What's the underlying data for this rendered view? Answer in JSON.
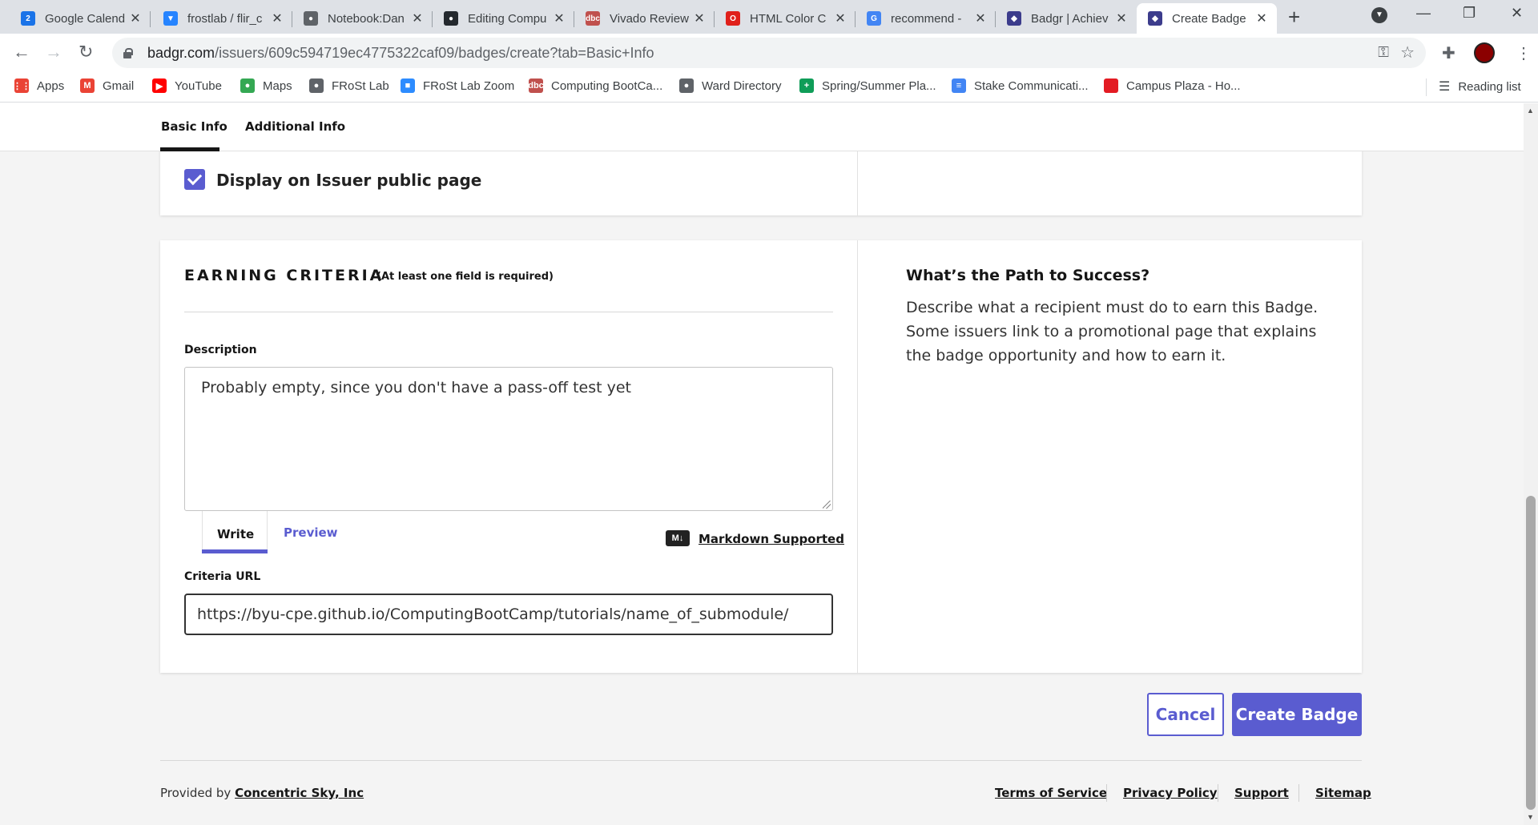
{
  "browser": {
    "tabs": [
      {
        "title": "Google Calend",
        "icon": "calendar-icon",
        "color": "#1a73e8",
        "glyph": "2"
      },
      {
        "title": "frostlab / flir_c",
        "icon": "bookmark-icon",
        "color": "#2684ff",
        "glyph": "▼"
      },
      {
        "title": "Notebook:Dan",
        "icon": "globe-icon",
        "color": "#5f6368",
        "glyph": "●"
      },
      {
        "title": "Editing Compu",
        "icon": "github-icon",
        "color": "#24292e",
        "glyph": "●"
      },
      {
        "title": "Vivado Review",
        "icon": "dbc-icon",
        "color": "#c0504d",
        "glyph": "dbc"
      },
      {
        "title": "HTML Color C",
        "icon": "opera-icon",
        "color": "#e0201b",
        "glyph": "O"
      },
      {
        "title": "recommend - ",
        "icon": "google-icon",
        "color": "#4285f4",
        "glyph": "G"
      },
      {
        "title": "Badgr | Achiev",
        "icon": "badgr-icon",
        "color": "#3c3c8c",
        "glyph": "◆"
      },
      {
        "title": "Create Badge",
        "icon": "badgr-icon",
        "color": "#3c3c8c",
        "glyph": "◆"
      }
    ],
    "url_host": "badgr.com",
    "url_path": "/issuers/609c594719ec4775322caf09/badges/create?tab=Basic+Info",
    "bookmarks": [
      {
        "label": "Apps",
        "icon": "apps-grid-icon",
        "color": "#ea4335",
        "glyph": "⋮⋮"
      },
      {
        "label": "Gmail",
        "icon": "gmail-icon",
        "color": "#ea4335",
        "glyph": "M"
      },
      {
        "label": "YouTube",
        "icon": "youtube-icon",
        "color": "#ff0000",
        "glyph": "▶"
      },
      {
        "label": "Maps",
        "icon": "maps-pin-icon",
        "color": "#34a853",
        "glyph": "●"
      },
      {
        "label": "FRoSt Lab",
        "icon": "globe-icon",
        "color": "#5f6368",
        "glyph": "●"
      },
      {
        "label": "FRoSt Lab Zoom",
        "icon": "zoom-icon",
        "color": "#2d8cff",
        "glyph": "■"
      },
      {
        "label": "Computing BootCa...",
        "icon": "dbc-icon",
        "color": "#c0504d",
        "glyph": "dbc"
      },
      {
        "label": "Ward Directory",
        "icon": "globe-icon",
        "color": "#5f6368",
        "glyph": "●"
      },
      {
        "label": "Spring/Summer Pla...",
        "icon": "sheets-icon",
        "color": "#0f9d58",
        "glyph": "+"
      },
      {
        "label": "Stake Communicati...",
        "icon": "docs-icon",
        "color": "#4285f4",
        "glyph": "≡"
      },
      {
        "label": "Campus Plaza - Ho...",
        "icon": "red-square-icon",
        "color": "#e31b23",
        "glyph": ""
      }
    ],
    "reading_list": "Reading list"
  },
  "page": {
    "subnav": {
      "basic": "Basic Info",
      "additional": "Additional Info"
    },
    "display_public": "Display on Issuer public page",
    "earning": {
      "title": "EARNING CRITERIA",
      "subtitle": "(At least one field is required)",
      "description_label": "Description",
      "description_value": "Probably empty, since you don't have a pass-off test yet",
      "write_tab": "Write",
      "preview_tab": "Preview",
      "markdown_badge": "M↓",
      "markdown_link": "Markdown Supported",
      "criteria_url_label": "Criteria URL",
      "criteria_url_value": "https://byu-cpe.github.io/ComputingBootCamp/tutorials/name_of_submodule/"
    },
    "side": {
      "title": "What’s the Path to Success?",
      "text": "Describe what a recipient must do to earn this Badge. Some issuers link to a promotional page that explains the badge opportunity and how to earn it."
    },
    "buttons": {
      "cancel": "Cancel",
      "create": "Create Badge"
    },
    "footer": {
      "provided_by": "Provided by",
      "company": "Concentric Sky, Inc",
      "links": [
        "Terms of Service",
        "Privacy Policy",
        "Support",
        "Sitemap"
      ]
    },
    "colors": {
      "accent": "#5a5cd0",
      "background": "#f4f4f4"
    }
  }
}
